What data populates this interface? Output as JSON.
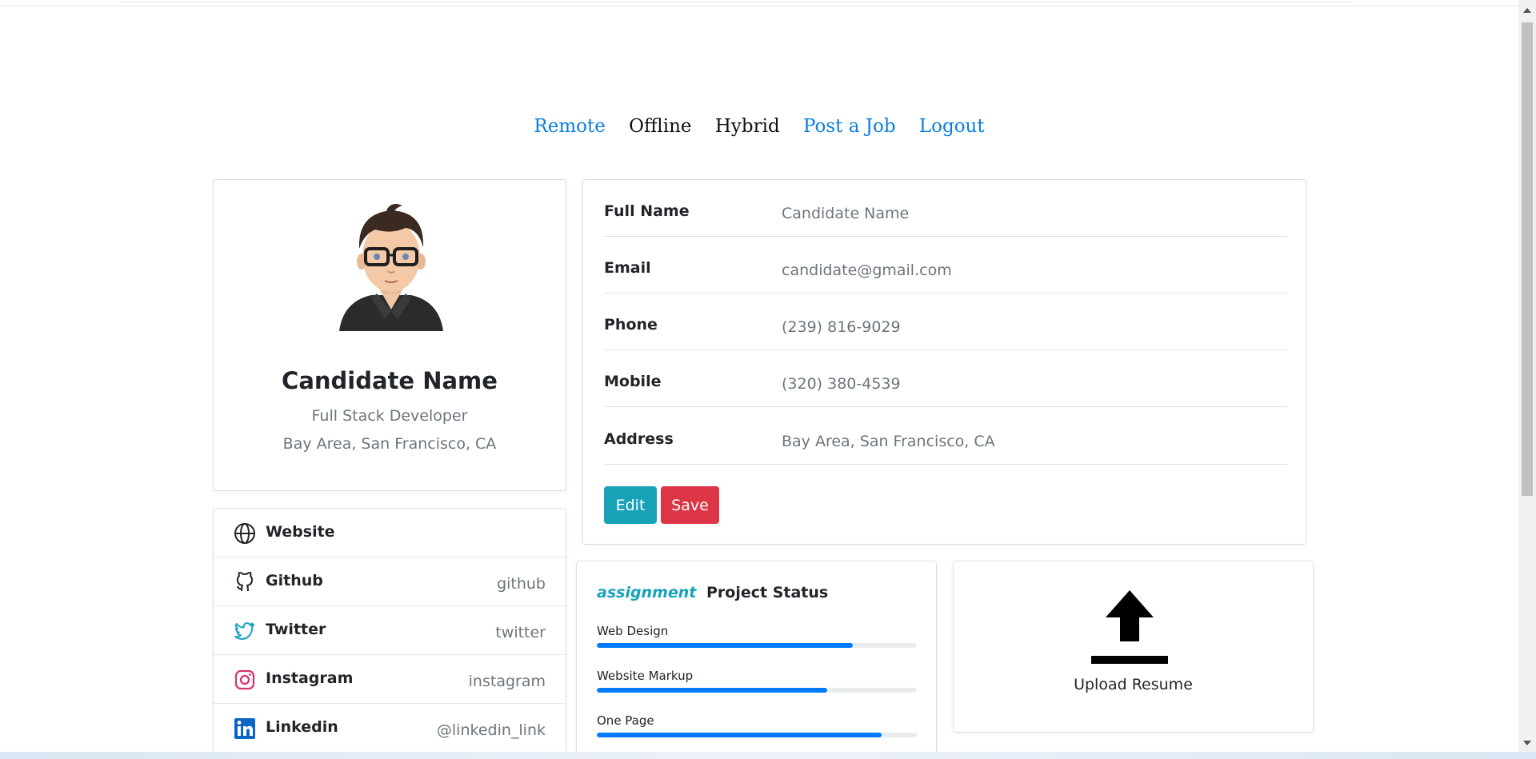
{
  "nav": {
    "items": [
      {
        "label": "Remote",
        "style": "link"
      },
      {
        "label": "Offline",
        "style": "plain"
      },
      {
        "label": "Hybrid",
        "style": "plain"
      },
      {
        "label": "Post a Job",
        "style": "link"
      },
      {
        "label": "Logout",
        "style": "link"
      }
    ]
  },
  "profile": {
    "name": "Candidate Name",
    "role": "Full Stack Developer",
    "location": "Bay Area, San Francisco, CA"
  },
  "social": [
    {
      "icon": "globe-icon",
      "label": "Website",
      "value": ""
    },
    {
      "icon": "github-icon",
      "label": "Github",
      "value": "github"
    },
    {
      "icon": "twitter-icon",
      "label": "Twitter",
      "value": "twitter"
    },
    {
      "icon": "instagram-icon",
      "label": "Instagram",
      "value": "instagram"
    },
    {
      "icon": "linkedin-icon",
      "label": "Linkedin",
      "value": "@linkedin_link"
    }
  ],
  "details": [
    {
      "label": "Full Name",
      "value": "Candidate Name"
    },
    {
      "label": "Email",
      "value": "candidate@gmail.com"
    },
    {
      "label": "Phone",
      "value": "(239) 816-9029"
    },
    {
      "label": "Mobile",
      "value": "(320) 380-4539"
    },
    {
      "label": "Address",
      "value": "Bay Area, San Francisco, CA"
    }
  ],
  "actions": {
    "edit": "Edit",
    "save": "Save"
  },
  "project": {
    "icon_text": "assignment",
    "title": "Project Status",
    "items": [
      {
        "label": "Web Design",
        "percent": 80
      },
      {
        "label": "Website Markup",
        "percent": 72
      },
      {
        "label": "One Page",
        "percent": 89
      }
    ]
  },
  "upload": {
    "label": "Upload Resume"
  },
  "colors": {
    "link": "#0b7ee0",
    "info": "#17a2b8",
    "danger": "#dc3545",
    "progress": "#007bff"
  }
}
